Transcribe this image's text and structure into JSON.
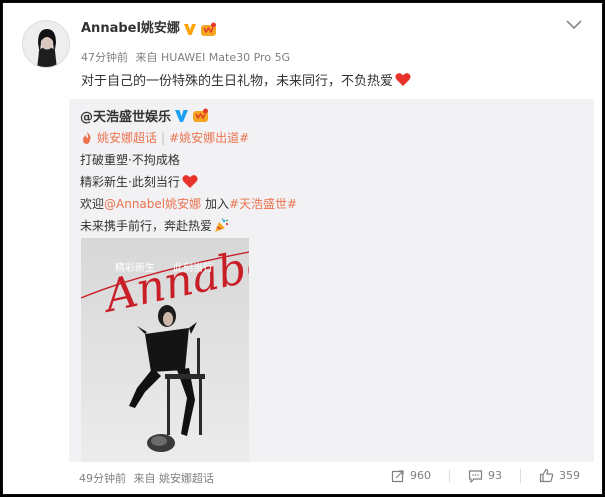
{
  "post": {
    "author": "Annabel姚安娜",
    "time": "47分钟前",
    "source": "来自 HUAWEI Mate30 Pro 5G",
    "text": "对于自己的一份特殊的生日礼物，未来同行，不负热爱"
  },
  "repost": {
    "author": "@天浩盛世娱乐",
    "tag_supertopic": "姚安娜超话",
    "tag_debut": "#姚安娜出道#",
    "line1": "打破重塑·不拘成格",
    "line2": "精彩新生·此刻当行",
    "welcome_prefix": "欢迎",
    "mention": "@Annabel姚安娜",
    "join_text": " 加入",
    "company_tag": "#天浩盛世#",
    "line4": "未来携手前行，奔赴热爱",
    "photo": {
      "script": "Annabel",
      "slogan_left": "精彩新生",
      "slogan_right": "此刻当行"
    }
  },
  "footer": {
    "time": "49分钟前",
    "source": "来自 姚安娜超话",
    "reposts": "960",
    "comments": "93",
    "likes": "359"
  },
  "colors": {
    "link": "#eb7350",
    "heart": "#e8332b",
    "verified": "#ffa200"
  }
}
